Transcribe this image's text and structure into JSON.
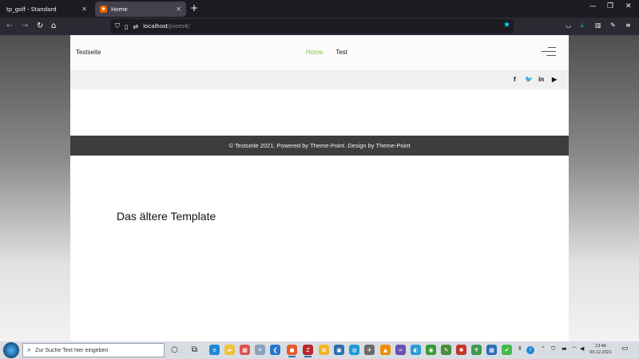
{
  "browser": {
    "tabs": [
      {
        "title": "tp_golf - Standard",
        "favicon": "none",
        "active": false
      },
      {
        "title": "Home",
        "favicon": "joomla-icon",
        "active": true
      }
    ],
    "new_tab": "+",
    "window_controls": {
      "minimize": "—",
      "restore": "❐",
      "close": "✕"
    },
    "url": {
      "host": "localhost",
      "path": "/joom4/"
    },
    "nav": {
      "back": "←",
      "forward": "→",
      "reload": "↻",
      "home": "⌂"
    },
    "accent_color": "#00ddff"
  },
  "site": {
    "title": "Testseite",
    "menu": [
      {
        "label": "Home",
        "active": true
      },
      {
        "label": "Test",
        "active": false
      }
    ],
    "active_color": "#7bc04b",
    "social": [
      {
        "icon": "facebook-icon",
        "glyph": "f"
      },
      {
        "icon": "twitter-icon",
        "glyph": "🐦"
      },
      {
        "icon": "linkedin-icon",
        "glyph": "in"
      },
      {
        "icon": "youtube-icon",
        "glyph": "▶"
      }
    ],
    "footer": "© Testseite 2021, Powered by Theme-Point. Design by Theme-Point",
    "body_text": "Das ältere Template"
  },
  "taskbar": {
    "search_placeholder": "Zur Suche Text hier eingeben",
    "clock_time": "13:46",
    "clock_date": "03.12.2021"
  }
}
